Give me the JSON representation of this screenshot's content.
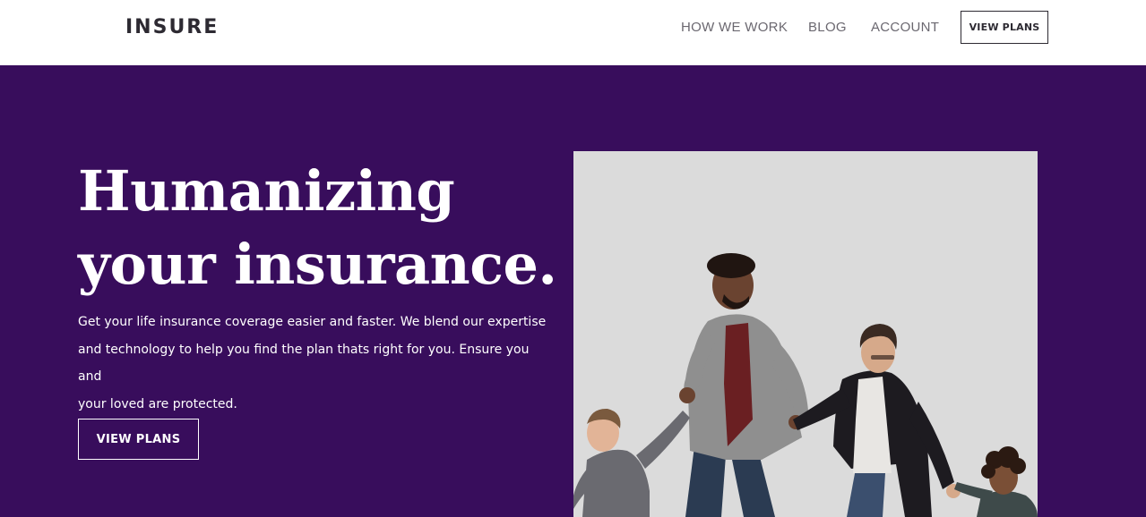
{
  "header": {
    "logo": "INSURE",
    "nav": [
      {
        "label": "HOW WE WORK"
      },
      {
        "label": "BLOG"
      },
      {
        "label": "ACCOUNT"
      }
    ],
    "cta_label": "VIEW PLANS"
  },
  "hero": {
    "title_line1": "Humanizing",
    "title_line2": "your insurance.",
    "text_line1": "Get your life insurance coverage easier and faster. We blend our expertise",
    "text_line2": "and technology to help you find the plan thats right for you. Ensure you and",
    "text_line3": "your loved are protected.",
    "cta_label": "VIEW PLANS",
    "background_color": "#380d5c"
  },
  "photo": {
    "icon": "family-photo"
  }
}
